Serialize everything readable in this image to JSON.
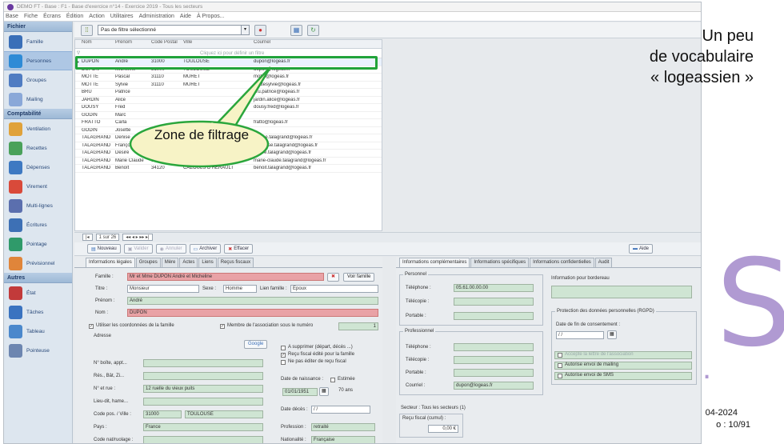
{
  "window": {
    "title": "DEMO FT - Base : F1 - Base d'exercice n°14 - Exercice 2019 - Tous les secteurs"
  },
  "menu": [
    "Base",
    "Fiche",
    "Écrans",
    "Édition",
    "Action",
    "Utilitaires",
    "Administration",
    "Aide",
    "À Propos..."
  ],
  "sidebar": {
    "sections": [
      {
        "title": "Fichier",
        "items": [
          {
            "label": "Famille",
            "color": "#3a6fb8"
          },
          {
            "label": "Personnes",
            "color": "#2e8bd6",
            "active": true
          },
          {
            "label": "Groupes",
            "color": "#4f7cc2"
          },
          {
            "label": "Mailing",
            "color": "#8aa8d8"
          }
        ]
      },
      {
        "title": "Comptabilité",
        "items": [
          {
            "label": "Ventilation",
            "color": "#e0a23a"
          },
          {
            "label": "Recettes",
            "color": "#4aa15a"
          },
          {
            "label": "Dépenses",
            "color": "#3e79c2"
          },
          {
            "label": "Virement",
            "color": "#d94a3a"
          },
          {
            "label": "Multi-lignes",
            "color": "#5b6fae"
          },
          {
            "label": "Écritures",
            "color": "#3d70b5"
          },
          {
            "label": "Pointage",
            "color": "#2f9a6a"
          },
          {
            "label": "Prévisionnel",
            "color": "#e0853a"
          }
        ]
      },
      {
        "title": "Autres",
        "items": [
          {
            "label": "État",
            "color": "#c23a3a"
          },
          {
            "label": "Tâches",
            "color": "#3a73c0"
          },
          {
            "label": "Tableau",
            "color": "#4b88cc"
          },
          {
            "label": "Pointeuse",
            "color": "#6d86b0"
          }
        ]
      }
    ]
  },
  "toolbar": {
    "filter_value": "Pas de filtre sélectionné"
  },
  "grid": {
    "headers": [
      "",
      "Nom",
      "Prénom",
      "Code Postal",
      "Ville",
      "Courriel"
    ],
    "filter_hint": "Cliquez ici pour définir un filtre",
    "rows": [
      [
        "DUPON",
        "André",
        "31000",
        "TOULOUSE",
        "dupon@logeas.fr"
      ],
      [
        "DUPON",
        "Micheline",
        "31000",
        "TOULOUSE",
        "dupon@logeas.fr"
      ],
      [
        "MOTTE",
        "Pascal",
        "31110",
        "MURET",
        "motte@logeas.fr"
      ],
      [
        "MOTTE",
        "Sylvie",
        "31110",
        "MURET",
        "mottesylvie@logeas.fr"
      ],
      [
        "BRU",
        "Patrice",
        "",
        "",
        "bru.patrice@logeas.fr"
      ],
      [
        "JARDIN",
        "Alice",
        "",
        "",
        "jardin.alice@logeas.fr"
      ],
      [
        "DOUSY",
        "Fred",
        "",
        "",
        "dousy.fred@logeas.fr"
      ],
      [
        "GODIN",
        "Marc",
        "",
        "",
        ""
      ],
      [
        "FRATTO",
        "Carla",
        "",
        "",
        "fratto@logeas.fr"
      ],
      [
        "GODIN",
        "Josette",
        "",
        "",
        ""
      ],
      [
        "TALAGRAND",
        "Denise",
        "",
        "",
        "denise.talagrand@logeas.fr"
      ],
      [
        "TALAGRAND",
        "Françoise",
        "25420",
        "VOUJEAUCOURT",
        "francoise.talagrand@logeas.fr"
      ],
      [
        "TALAGRAND",
        "Désiré",
        "34120",
        "CAZOULS D'HERAULT",
        "desire.talagrand@logeas.fr"
      ],
      [
        "TALAGRAND",
        "Marie Claude",
        "34120",
        "CAZOULS D'HERAULT",
        "marie-claude.talagrand@logeas.fr"
      ],
      [
        "TALAGRAND",
        "Benoît",
        "34120",
        "CAZOULS D'HERAULT",
        "benoit.talagrand@logeas.fr"
      ]
    ]
  },
  "nav": {
    "position": "1 sur 26"
  },
  "callout": {
    "text": "Zone de filtrage"
  },
  "actions": {
    "new": "Nouveau",
    "save": "Valider",
    "cancel": "Annuler",
    "archive": "Archiver",
    "delete": "Effacer",
    "help": "Aide"
  },
  "left_tabs": [
    "Informations légales",
    "Groupes",
    "Mère",
    "Actes",
    "Liens",
    "Reçus fiscaux"
  ],
  "form": {
    "famille_label": "Famille :",
    "famille_value": "Mr et Mme DUPON André et Micheline",
    "voir_famille": "Voir famille",
    "titre_label": "Titre :",
    "titre_value": "Monsieur",
    "sexe_label": "Sexe :",
    "sexe_value": "Homme",
    "lien_label": "Lien famille :",
    "lien_value": "Époux",
    "prenom_label": "Prénom :",
    "prenom_value": "André",
    "nom_label": "Nom :",
    "nom_value": "DUPON",
    "use_coords": "Utiliser les coordonnées de la famille",
    "membre_assoc": "Membre de l'association sous le numéro",
    "membre_num": "1",
    "adresse_label": "Adresse",
    "google": "Google",
    "boite_label": "N° boîte, appt...",
    "res_label": "Rés., Bât, Zi...",
    "rue_label": "N° et rue :",
    "rue_value": "12 ruelle du vieux puits",
    "lieu_label": "Lieu-dit, hame...",
    "cp_label": "Code pos. / Ville :",
    "cp_value": "31000",
    "ville_value": "TOULOUSE",
    "pays_label": "Pays :",
    "pays_value": "France",
    "cnat_label": "Code nat/ruolage :",
    "supprimer": "A supprimer (départ, décès ...)",
    "recu_fiscal": "Reçu fiscal édité pour la famille",
    "ne_pas_editer": "Ne pas éditer de reçu fiscal",
    "naissance_label": "Date de naissance :",
    "estimee": "Estimée",
    "naissance_value": "01/01/1951",
    "age": "70 ans",
    "deces_label": "Date décès :",
    "deces_value": "/ /",
    "profession_label": "Profession :",
    "profession_value": "retraité",
    "nationalite_label": "Nationalité :",
    "nationalite_value": "Française"
  },
  "right_tabs": [
    "Informations complémentaires",
    "Informations spécifiques",
    "Informations confidentielles",
    "Audit"
  ],
  "right": {
    "personnel": "Personnel",
    "telephone_label": "Téléphone :",
    "telephone_value": "05.61.00.00.00",
    "telecopie_label": "Télécopie :",
    "portable_label": "Portable :",
    "professionnel": "Professionnel",
    "ptel_label": "Téléphone :",
    "ptelecopie_label": "Télécopie :",
    "pportable_label": "Portable :",
    "courriel_label": "Courriel :",
    "courriel_value": "dupon@logeas.fr",
    "bordereau": "Information pour bordereau",
    "rgpd": "Protection des données personnelles (RGPD)",
    "fin_consent": "Date de fin de consentement :",
    "fin_value": "/ /",
    "opt1": "Accepte la lettre de l'association",
    "opt2": "Autorise envoi de mailing",
    "opt3": "Autorise envoi de SMS",
    "secteur": "Secteur : Tous les secteurs (1)",
    "recu_cumul": "Reçu fiscal (cumul) :",
    "recu_value": "0,00 €"
  },
  "slide": {
    "title_line1": "Un peu",
    "title_line2": "de vocabulaire",
    "title_line3": "« logeassien »",
    "date": "04-2024",
    "page": "o : 10/91",
    "logo_letter": "S",
    "logo_dot": "."
  },
  "colors": {
    "highlight": "#21a33a",
    "logo": "#b09ad2",
    "field_green": "#cfe5d3",
    "field_red": "#e9a2a6"
  }
}
